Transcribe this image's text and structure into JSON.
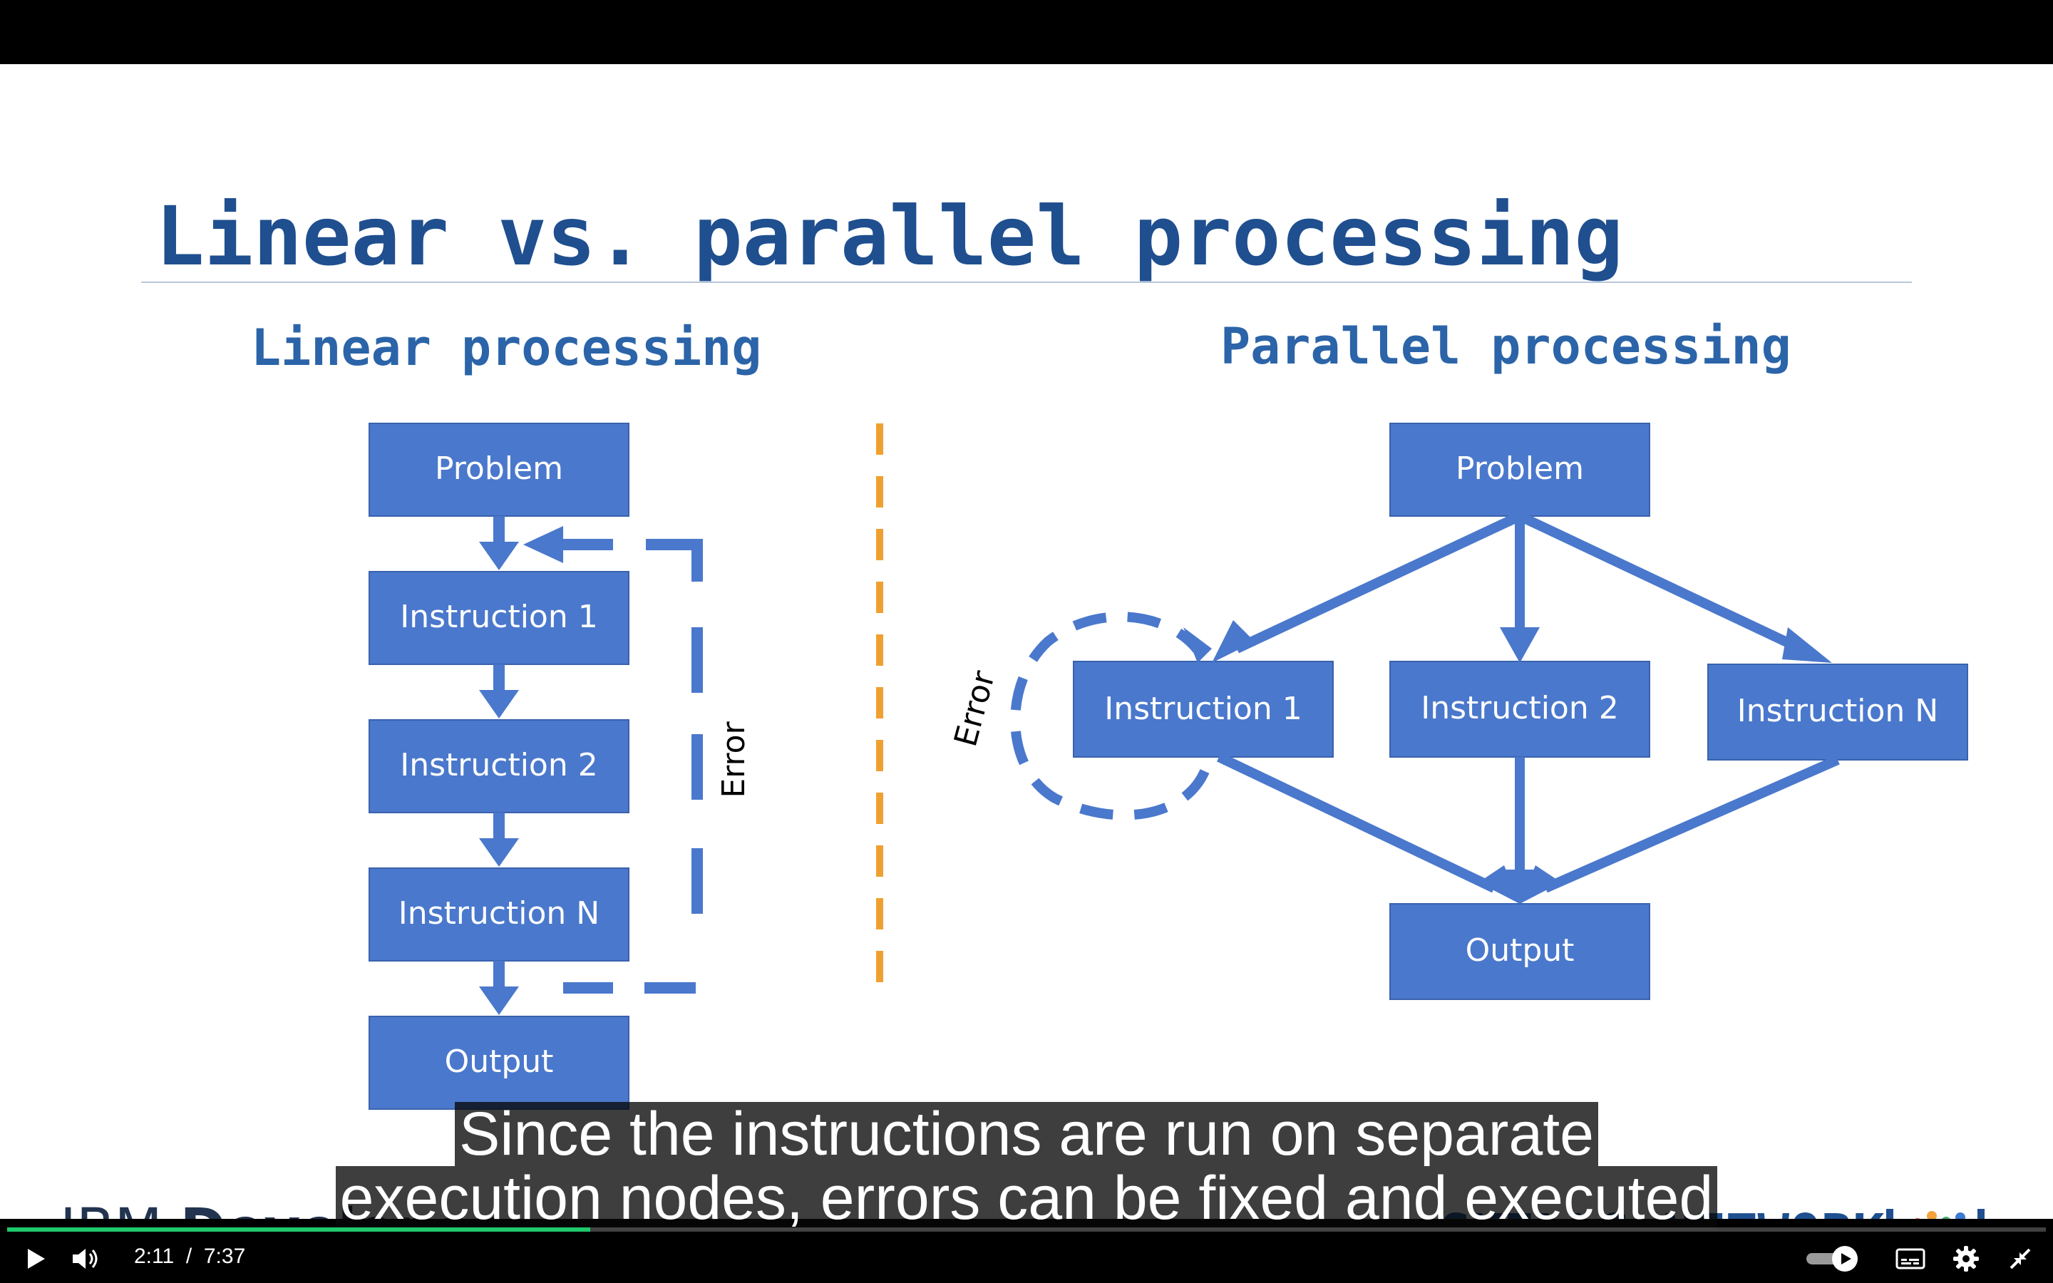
{
  "slide": {
    "title": "Linear vs. parallel processing",
    "linear": {
      "heading": "Linear processing",
      "boxes": [
        "Problem",
        "Instruction 1",
        "Instruction 2",
        "Instruction N",
        "Output"
      ],
      "error_label": "Error"
    },
    "parallel": {
      "heading": "Parallel processing",
      "problem": "Problem",
      "instr1": "Instruction 1",
      "instr2": "Instruction 2",
      "instrN": "Instruction N",
      "output": "Output",
      "error_label": "Error"
    },
    "brand_left": {
      "light": "IBM ",
      "bold": "Developer"
    },
    "brand_right": "SKILLS NETWORK",
    "colors": {
      "box": "#4a78cc",
      "title": "#1f4f8f",
      "divider": "#f0a030"
    }
  },
  "captions": {
    "line1": "Since the instructions are run on separate",
    "line2": "execution nodes, errors can be fixed and executed"
  },
  "player": {
    "current_time": "2:11",
    "separator": "/",
    "duration": "7:37",
    "progress_fraction": 0.286,
    "icons": {
      "play": "play-icon",
      "volume": "volume-icon",
      "autoplay": "autoplay-toggle-icon",
      "captions": "captions-icon",
      "settings": "gear-icon",
      "exit_fullscreen": "exit-fullscreen-icon"
    }
  }
}
